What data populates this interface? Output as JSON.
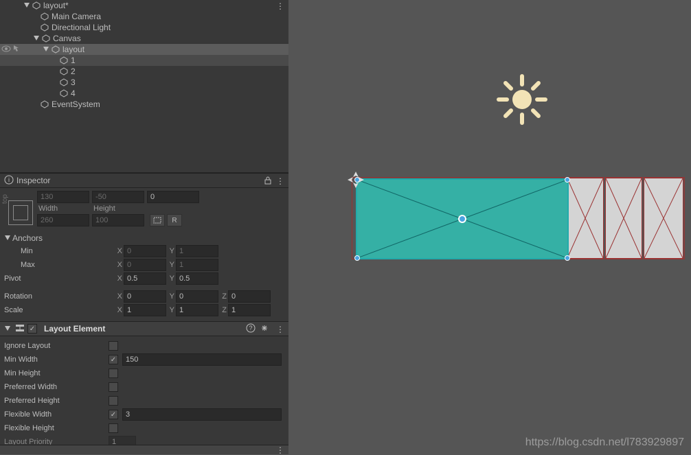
{
  "hierarchy": {
    "root": "layout*",
    "mainCam": "Main Camera",
    "dirLight": "Directional Light",
    "canvas": "Canvas",
    "layoutObj": "layout",
    "c1": "1",
    "c2": "2",
    "c3": "3",
    "c4": "4",
    "eventSys": "EventSystem"
  },
  "inspector": {
    "title": "Inspector"
  },
  "rectTransform": {
    "anchor_top_label": "top",
    "posX": "130",
    "posY": "-50",
    "posZ": "0",
    "widthLabel": "Width",
    "heightLabel": "Height",
    "width": "260",
    "height": "100",
    "rBtn": "R"
  },
  "anchors": {
    "header": "Anchors",
    "minLabel": "Min",
    "maxLabel": "Max",
    "minX": "0",
    "minY": "1",
    "maxX": "0",
    "maxY": "1"
  },
  "pivot": {
    "label": "Pivot",
    "x": "0.5",
    "y": "0.5"
  },
  "rotation": {
    "label": "Rotation",
    "x": "0",
    "y": "0",
    "z": "0"
  },
  "scale": {
    "label": "Scale",
    "x": "1",
    "y": "1",
    "z": "1"
  },
  "axes": {
    "x": "X",
    "y": "Y",
    "z": "Z"
  },
  "layoutElement": {
    "title": "Layout Element",
    "ignore": "Ignore Layout",
    "minW": "Min Width",
    "minWVal": "150",
    "minH": "Min Height",
    "prefW": "Preferred Width",
    "prefH": "Preferred Height",
    "flexW": "Flexible Width",
    "flexWVal": "3",
    "flexH": "Flexible Height",
    "prio": "Layout Priority",
    "prioVal": "1"
  },
  "watermark": "https://blog.csdn.net/l783929897"
}
